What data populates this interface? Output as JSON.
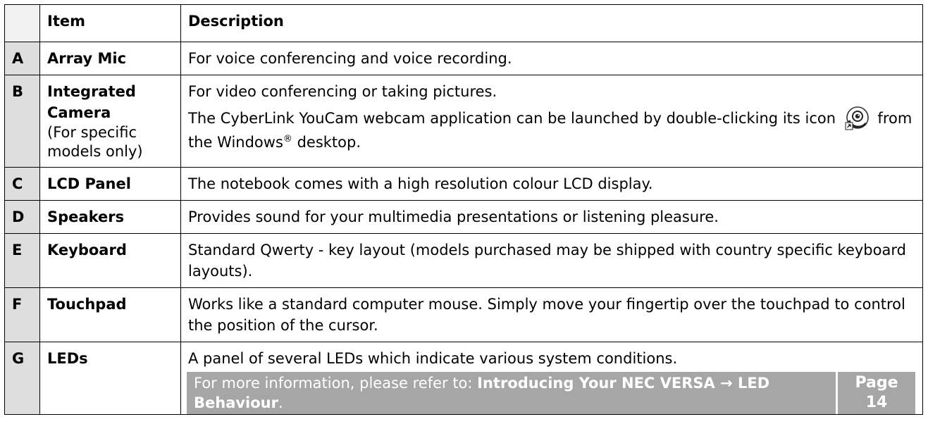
{
  "table": {
    "headers": {
      "letter": "",
      "item": "Item",
      "description": "Description"
    },
    "rows": [
      {
        "letter": "A",
        "item": "Array Mic",
        "desc": "For voice conferencing and voice recording."
      },
      {
        "letter": "B",
        "item": "Integrated Camera",
        "item_sub": "(For specific models only)",
        "desc_line1": "For video conferencing or taking pictures.",
        "desc_line2_a": "The CyberLink YouCam webcam application can be launched by double-clicking its icon",
        "desc_line2_b": "from the Windows",
        "desc_line2_reg": "®",
        "desc_line2_c": "desktop.",
        "icon": "youcam-icon"
      },
      {
        "letter": "C",
        "item": "LCD Panel",
        "desc": "The notebook comes with a high resolution colour LCD display."
      },
      {
        "letter": "D",
        "item": "Speakers",
        "desc": "Provides sound for your multimedia presentations or listening pleasure."
      },
      {
        "letter": "E",
        "item": "Keyboard",
        "desc": "Standard Qwerty - key layout (models purchased may be shipped with country specific keyboard layouts)."
      },
      {
        "letter": "F",
        "item": "Touchpad",
        "desc": "Works like a standard computer mouse. Simply move your fingertip over the touchpad to control the position of the cursor."
      },
      {
        "letter": "G",
        "item": "LEDs",
        "desc": "A panel of several LEDs which indicate various system conditions.",
        "note_prefix": "For more information, please refer to:",
        "note_link": "Introducing Your NEC VERSA → LED Behaviour",
        "note_suffix": ".",
        "page_label": "Page",
        "page_number": "14"
      }
    ]
  },
  "colors": {
    "letter_bg": "#dedede",
    "note_bg": "#a6a6a6",
    "note_text": "#ffffff"
  }
}
